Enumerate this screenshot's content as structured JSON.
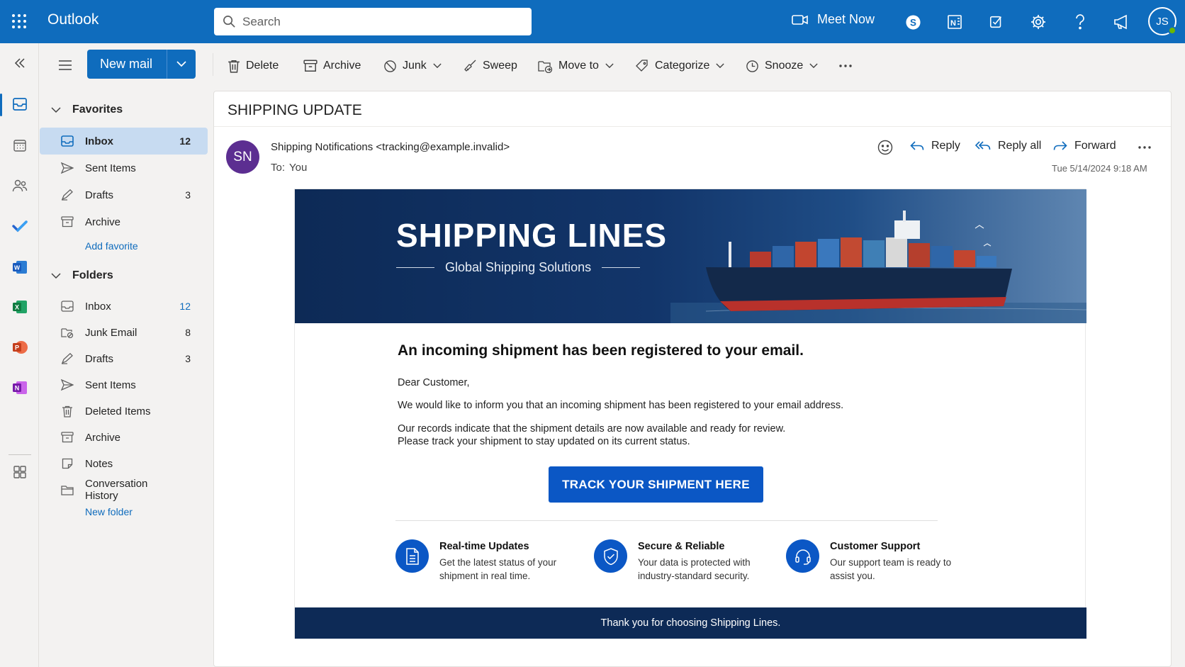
{
  "app": {
    "name": "Outlook"
  },
  "search": {
    "placeholder": "Search"
  },
  "topbar": {
    "meet_now": "Meet Now",
    "avatar_initials": "JS"
  },
  "rail": {
    "items": [
      "collapse-icon",
      "mail-icon",
      "calendar-icon",
      "people-icon",
      "todo-icon",
      "word-icon",
      "excel-icon",
      "powerpoint-icon",
      "onenote-icon",
      "apps-icon"
    ]
  },
  "new_mail": {
    "label": "New mail"
  },
  "favorites": {
    "title": "Favorites",
    "items": [
      {
        "label": "Inbox",
        "count": "12"
      },
      {
        "label": "Sent Items",
        "count": ""
      },
      {
        "label": "Drafts",
        "count": "3"
      },
      {
        "label": "Archive",
        "count": ""
      }
    ],
    "add_link": "Add favorite"
  },
  "folders": {
    "title": "Folders",
    "items": [
      {
        "label": "Inbox",
        "count": "12"
      },
      {
        "label": "Junk Email",
        "count": "8"
      },
      {
        "label": "Drafts",
        "count": "3"
      },
      {
        "label": "Sent Items",
        "count": ""
      },
      {
        "label": "Deleted Items",
        "count": ""
      },
      {
        "label": "Archive",
        "count": ""
      },
      {
        "label": "Notes",
        "count": ""
      },
      {
        "label": "Conversation History",
        "count": ""
      }
    ],
    "new_link": "New folder"
  },
  "commands": {
    "delete": "Delete",
    "archive": "Archive",
    "junk": "Junk",
    "sweep": "Sweep",
    "move_to": "Move to",
    "categorize": "Categorize",
    "snooze": "Snooze"
  },
  "message": {
    "subject": "SHIPPING UPDATE",
    "sender_initials": "SN",
    "from": "Shipping Notifications <tracking@example.invalid>",
    "to_label": "To:",
    "to_value": "You",
    "reply": "Reply",
    "reply_all": "Reply all",
    "forward": "Forward",
    "date": "Tue 5/14/2024 9:18 AM"
  },
  "email": {
    "banner_title": "SHIPPING LINES",
    "banner_subtitle": "Global Shipping Solutions",
    "heading": "An incoming shipment has been registered to your email.",
    "greeting": "Dear Customer,",
    "para1": "We would like to inform you that an incoming shipment has been registered to your email address.",
    "para2": "Our records indicate that the shipment details are now available and ready for review. Please track your shipment to stay updated on its current status.",
    "cta": "TRACK YOUR SHIPMENT HERE",
    "features": [
      {
        "title": "Real-time Updates",
        "desc": "Get the latest status of your shipment in real time."
      },
      {
        "title": "Secure & Reliable",
        "desc": "Your data is protected with industry-standard security."
      },
      {
        "title": "Customer Support",
        "desc": "Our support team is ready to assist you."
      }
    ],
    "footer": "Thank you for choosing Shipping Lines."
  },
  "colors": {
    "brand": "#0f6cbd",
    "email_navy": "#0d2a56",
    "cta_blue": "#0b57c5",
    "selected": "#c7dbf1"
  }
}
